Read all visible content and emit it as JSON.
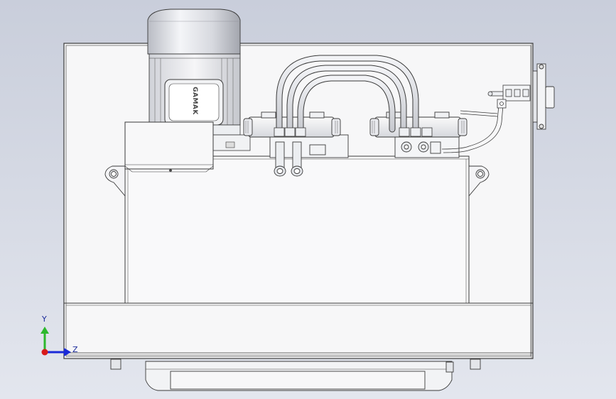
{
  "viewport": {
    "background_top": "#c9cedb",
    "background_bottom": "#e3e6ee",
    "line_color": "#3a3a3a"
  },
  "motor": {
    "nameplate_text": "GAMAK"
  },
  "triad": {
    "y_label": "Y",
    "z_label": "Z",
    "y_color": "#2db82d",
    "z_color": "#1a2ad8",
    "origin_color": "#d81a1a"
  }
}
